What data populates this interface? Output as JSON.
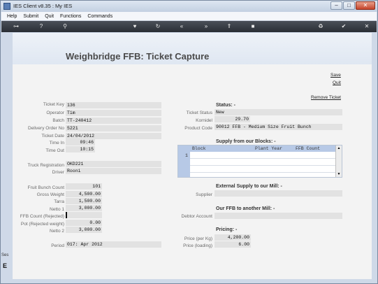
{
  "window": {
    "title": "IES Client v8.35 : My IES",
    "btn_min": "–",
    "btn_max": "□",
    "btn_close": "✕"
  },
  "menu": [
    "Help",
    "Submit",
    "Quit",
    "Functions",
    "Commands"
  ],
  "toolbar": {
    "icons": [
      "key-icon",
      "help-icon",
      "search-icon",
      "heart-icon",
      "refresh-icon",
      "rewind-icon",
      "fast-forward-icon",
      "upload-icon",
      "stop-icon",
      "recycle-icon",
      "check-icon",
      "close-icon"
    ],
    "glyphs": {
      "key": "⊶",
      "help": "?",
      "search": "⚲",
      "heart": "♥",
      "refresh": "↻",
      "rewind": "«",
      "forward": "»",
      "upload": "⇑",
      "stop": "■",
      "recycle": "♻",
      "check": "✔",
      "close": "✕"
    }
  },
  "page": {
    "title": "Weighbridge FFB: Ticket Capture"
  },
  "links": {
    "save": "Save",
    "quit": "Quit",
    "remove": "Remove Ticket"
  },
  "left_fields": {
    "ticket_key": {
      "label": "Ticket Key",
      "value": "136"
    },
    "operator": {
      "label": "Operator",
      "value": "Tim"
    },
    "batch": {
      "label": "Batch",
      "value": "TT-240412"
    },
    "delivery_order": {
      "label": "Delivery Order No",
      "value": "5221"
    },
    "ticket_date": {
      "label": "Ticket Date",
      "value": "24/04/2012"
    },
    "time_in": {
      "label": "Time In",
      "value": "09:46"
    },
    "time_out": {
      "label": "Time Out",
      "value": "10:15"
    },
    "truck_registration": {
      "label": "Truck Registration",
      "value": "OKD221"
    },
    "driver": {
      "label": "Driver",
      "value": "Rooni"
    },
    "fruit_bunch_count": {
      "label": "Fruit Bunch Count",
      "value": "101"
    },
    "gross_weight": {
      "label": "Gross Weight",
      "value": "4,500.00"
    },
    "tarra": {
      "label": "Tarra",
      "value": "1,500.00"
    },
    "netto1": {
      "label": "Netto 1",
      "value": "3,000.00"
    },
    "ffb_rejected": {
      "label": "FFB Count (Rejected)",
      "value": ""
    },
    "pot_rejected": {
      "label": "Pot (Rejected weight)",
      "value": "0.00"
    },
    "netto2": {
      "label": "Netto 2",
      "value": "3,000.00"
    },
    "period": {
      "label": "Period",
      "value": "017: Apr 2012"
    }
  },
  "status": {
    "heading": "Status: -",
    "ticket_status": {
      "label": "Ticket Status",
      "value": "New"
    },
    "kornidel": {
      "label": "Kornidel",
      "value": "29.70"
    },
    "product_code": {
      "label": "Product Code",
      "value": "90012 FFB - Medium Size Fruit Bunch"
    }
  },
  "blocks": {
    "heading": "Supply from our Blocks: -",
    "columns": [
      "Block",
      "Plant Year",
      "FFB Count"
    ],
    "row_number": "1",
    "scroll_up": "▲",
    "scroll_down": "▼"
  },
  "external": {
    "heading": "External Supply to our Mill: -",
    "supplier_label": "Supplier",
    "supplier_value": ""
  },
  "our_ffb": {
    "heading": "Our FFB to another Mill: -",
    "debtor_label": "Debtor Account",
    "debtor_value": ""
  },
  "pricing": {
    "heading": "Pricing: -",
    "price_per_kg": {
      "label": "Price (per Kg)",
      "value": "4,200.00"
    },
    "price_loading": {
      "label": "Price (loading)",
      "value": "6.00"
    }
  },
  "left_strip": {
    "text": "Ses",
    "glyph": "E"
  }
}
